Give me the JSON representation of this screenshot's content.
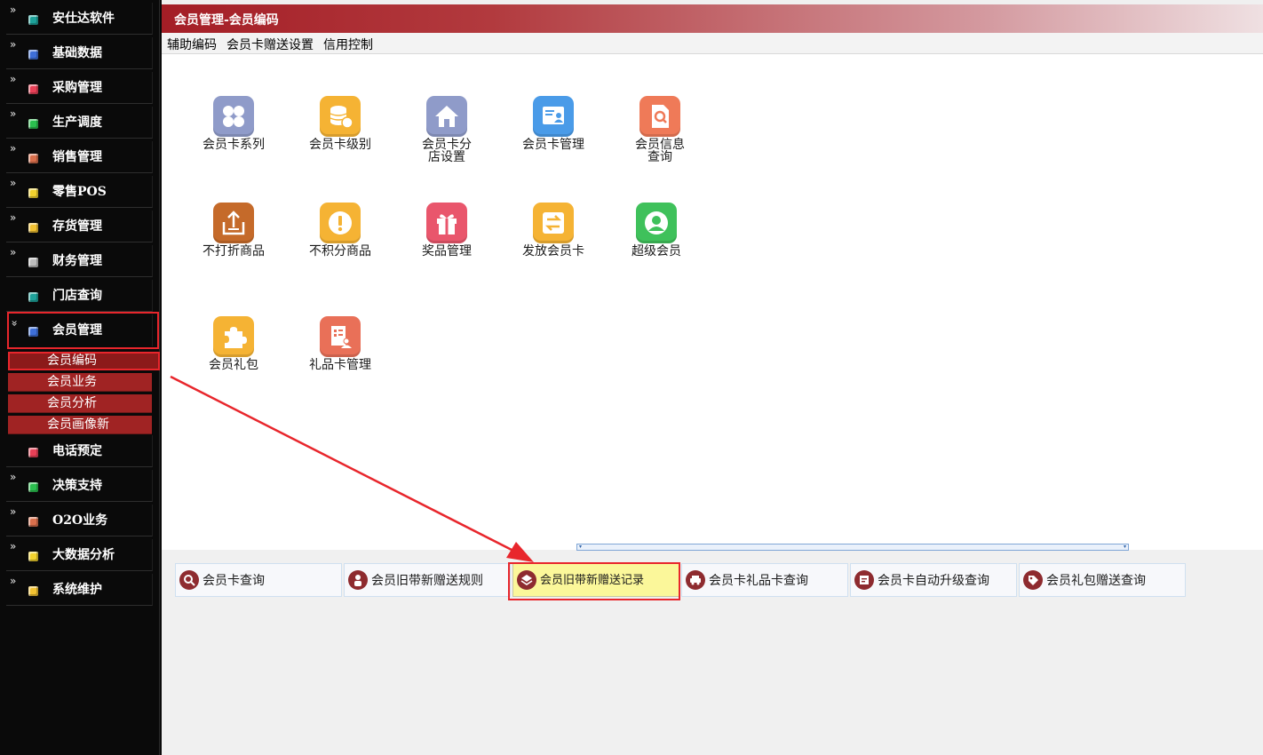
{
  "sidebar": {
    "items": [
      {
        "label": "安仕达软件",
        "arrow": "»",
        "color": "#1ea29a"
      },
      {
        "label": "基础数据",
        "arrow": "»",
        "color": "#3e6fd8"
      },
      {
        "label": "采购管理",
        "arrow": "»",
        "color": "#e84057"
      },
      {
        "label": "生产调度",
        "arrow": "»",
        "color": "#2bc04f"
      },
      {
        "label": "销售管理",
        "arrow": "»",
        "color": "#d96f4c"
      },
      {
        "label": "零售POS",
        "arrow": "»",
        "color": "#f2d22e"
      },
      {
        "label": "存货管理",
        "arrow": "»",
        "color": "#f2c232"
      },
      {
        "label": "财务管理",
        "arrow": "»",
        "color": "#bcbcbc"
      },
      {
        "label": "门店查询",
        "arrow": "",
        "color": "#1ea29a"
      },
      {
        "label": "会员管理",
        "arrow": "»",
        "color": "#3e6fd8"
      },
      {
        "label": "电话预定",
        "arrow": "",
        "color": "#e84057"
      },
      {
        "label": "决策支持",
        "arrow": "»",
        "color": "#2bc04f"
      },
      {
        "label": "O2O业务",
        "arrow": "»",
        "color": "#d96f4c"
      },
      {
        "label": "大数据分析",
        "arrow": "»",
        "color": "#f2d22e"
      },
      {
        "label": "系统维护",
        "arrow": "»",
        "color": "#f2c232"
      }
    ],
    "subitems": [
      {
        "label": "会员编码"
      },
      {
        "label": "会员业务"
      },
      {
        "label": "会员分析"
      },
      {
        "label": "会员画像新"
      }
    ]
  },
  "title": "会员管理-会员编码",
  "menu": [
    {
      "label": "辅助编码"
    },
    {
      "label": "会员卡赠送设置"
    },
    {
      "label": "信用控制"
    }
  ],
  "tiles": [
    {
      "label": "会员卡系列",
      "color": "#8f9bc9",
      "icon": "grid-icon"
    },
    {
      "label": "会员卡级别",
      "color": "#f5b334",
      "icon": "coins-icon"
    },
    {
      "label": "会员卡分店设置",
      "color": "#8f9bc9",
      "icon": "house-icon"
    },
    {
      "label": "会员卡管理",
      "color": "#4a9be8",
      "icon": "id-card-icon"
    },
    {
      "label": "会员信息查询",
      "color": "#ef7a58",
      "icon": "doc-search-icon"
    },
    {
      "label": "不打折商品",
      "color": "#c56a2a",
      "icon": "export-icon"
    },
    {
      "label": "不积分商品",
      "color": "#f5b334",
      "icon": "exclamation-icon"
    },
    {
      "label": "奖品管理",
      "color": "#e9566c",
      "icon": "gift-icon"
    },
    {
      "label": "发放会员卡",
      "color": "#f5b334",
      "icon": "exchange-icon"
    },
    {
      "label": "超级会员",
      "color": "#3fc15b",
      "icon": "user-icon"
    },
    {
      "label": "会员礼包",
      "color": "#f5b334",
      "icon": "puzzle-icon"
    },
    {
      "label": "礼品卡管理",
      "color": "#e97058",
      "icon": "doc-user-icon"
    }
  ],
  "scrollbar": {
    "left": "▾",
    "right": "▾"
  },
  "quick": [
    {
      "label": "会员卡查询",
      "icon": "search-icon"
    },
    {
      "label": "会员旧带新赠送规则",
      "icon": "person-icon"
    },
    {
      "label": "会员旧带新赠送记录",
      "icon": "layers-icon"
    },
    {
      "label": "会员卡礼品卡查询",
      "icon": "car-icon"
    },
    {
      "label": "会员卡自动升级查询",
      "icon": "text-doc-icon"
    },
    {
      "label": "会员礼包赠送查询",
      "icon": "tag-icon"
    }
  ],
  "colors": {
    "accent": "#a02323",
    "highlight": "#e8262c",
    "arrow": "#e8262c"
  }
}
